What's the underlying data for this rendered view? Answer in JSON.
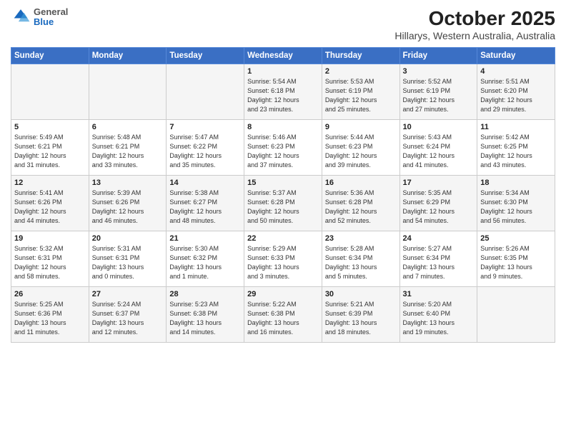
{
  "header": {
    "logo_general": "General",
    "logo_blue": "Blue",
    "title": "October 2025",
    "subtitle": "Hillarys, Western Australia, Australia"
  },
  "weekdays": [
    "Sunday",
    "Monday",
    "Tuesday",
    "Wednesday",
    "Thursday",
    "Friday",
    "Saturday"
  ],
  "rows": [
    [
      {
        "day": "",
        "info": ""
      },
      {
        "day": "",
        "info": ""
      },
      {
        "day": "",
        "info": ""
      },
      {
        "day": "1",
        "info": "Sunrise: 5:54 AM\nSunset: 6:18 PM\nDaylight: 12 hours\nand 23 minutes."
      },
      {
        "day": "2",
        "info": "Sunrise: 5:53 AM\nSunset: 6:19 PM\nDaylight: 12 hours\nand 25 minutes."
      },
      {
        "day": "3",
        "info": "Sunrise: 5:52 AM\nSunset: 6:19 PM\nDaylight: 12 hours\nand 27 minutes."
      },
      {
        "day": "4",
        "info": "Sunrise: 5:51 AM\nSunset: 6:20 PM\nDaylight: 12 hours\nand 29 minutes."
      }
    ],
    [
      {
        "day": "5",
        "info": "Sunrise: 5:49 AM\nSunset: 6:21 PM\nDaylight: 12 hours\nand 31 minutes."
      },
      {
        "day": "6",
        "info": "Sunrise: 5:48 AM\nSunset: 6:21 PM\nDaylight: 12 hours\nand 33 minutes."
      },
      {
        "day": "7",
        "info": "Sunrise: 5:47 AM\nSunset: 6:22 PM\nDaylight: 12 hours\nand 35 minutes."
      },
      {
        "day": "8",
        "info": "Sunrise: 5:46 AM\nSunset: 6:23 PM\nDaylight: 12 hours\nand 37 minutes."
      },
      {
        "day": "9",
        "info": "Sunrise: 5:44 AM\nSunset: 6:23 PM\nDaylight: 12 hours\nand 39 minutes."
      },
      {
        "day": "10",
        "info": "Sunrise: 5:43 AM\nSunset: 6:24 PM\nDaylight: 12 hours\nand 41 minutes."
      },
      {
        "day": "11",
        "info": "Sunrise: 5:42 AM\nSunset: 6:25 PM\nDaylight: 12 hours\nand 43 minutes."
      }
    ],
    [
      {
        "day": "12",
        "info": "Sunrise: 5:41 AM\nSunset: 6:26 PM\nDaylight: 12 hours\nand 44 minutes."
      },
      {
        "day": "13",
        "info": "Sunrise: 5:39 AM\nSunset: 6:26 PM\nDaylight: 12 hours\nand 46 minutes."
      },
      {
        "day": "14",
        "info": "Sunrise: 5:38 AM\nSunset: 6:27 PM\nDaylight: 12 hours\nand 48 minutes."
      },
      {
        "day": "15",
        "info": "Sunrise: 5:37 AM\nSunset: 6:28 PM\nDaylight: 12 hours\nand 50 minutes."
      },
      {
        "day": "16",
        "info": "Sunrise: 5:36 AM\nSunset: 6:28 PM\nDaylight: 12 hours\nand 52 minutes."
      },
      {
        "day": "17",
        "info": "Sunrise: 5:35 AM\nSunset: 6:29 PM\nDaylight: 12 hours\nand 54 minutes."
      },
      {
        "day": "18",
        "info": "Sunrise: 5:34 AM\nSunset: 6:30 PM\nDaylight: 12 hours\nand 56 minutes."
      }
    ],
    [
      {
        "day": "19",
        "info": "Sunrise: 5:32 AM\nSunset: 6:31 PM\nDaylight: 12 hours\nand 58 minutes."
      },
      {
        "day": "20",
        "info": "Sunrise: 5:31 AM\nSunset: 6:31 PM\nDaylight: 13 hours\nand 0 minutes."
      },
      {
        "day": "21",
        "info": "Sunrise: 5:30 AM\nSunset: 6:32 PM\nDaylight: 13 hours\nand 1 minute."
      },
      {
        "day": "22",
        "info": "Sunrise: 5:29 AM\nSunset: 6:33 PM\nDaylight: 13 hours\nand 3 minutes."
      },
      {
        "day": "23",
        "info": "Sunrise: 5:28 AM\nSunset: 6:34 PM\nDaylight: 13 hours\nand 5 minutes."
      },
      {
        "day": "24",
        "info": "Sunrise: 5:27 AM\nSunset: 6:34 PM\nDaylight: 13 hours\nand 7 minutes."
      },
      {
        "day": "25",
        "info": "Sunrise: 5:26 AM\nSunset: 6:35 PM\nDaylight: 13 hours\nand 9 minutes."
      }
    ],
    [
      {
        "day": "26",
        "info": "Sunrise: 5:25 AM\nSunset: 6:36 PM\nDaylight: 13 hours\nand 11 minutes."
      },
      {
        "day": "27",
        "info": "Sunrise: 5:24 AM\nSunset: 6:37 PM\nDaylight: 13 hours\nand 12 minutes."
      },
      {
        "day": "28",
        "info": "Sunrise: 5:23 AM\nSunset: 6:38 PM\nDaylight: 13 hours\nand 14 minutes."
      },
      {
        "day": "29",
        "info": "Sunrise: 5:22 AM\nSunset: 6:38 PM\nDaylight: 13 hours\nand 16 minutes."
      },
      {
        "day": "30",
        "info": "Sunrise: 5:21 AM\nSunset: 6:39 PM\nDaylight: 13 hours\nand 18 minutes."
      },
      {
        "day": "31",
        "info": "Sunrise: 5:20 AM\nSunset: 6:40 PM\nDaylight: 13 hours\nand 19 minutes."
      },
      {
        "day": "",
        "info": ""
      }
    ]
  ]
}
